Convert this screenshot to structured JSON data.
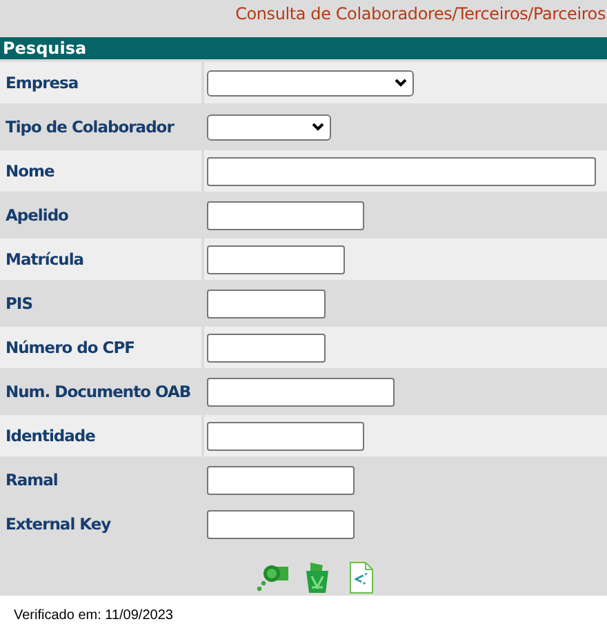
{
  "page_title": "Consulta de Colaboradores/Terceiros/Parceiros",
  "section": {
    "title": "Pesquisa"
  },
  "fields": [
    {
      "label": "Empresa",
      "kind": "select"
    },
    {
      "label": "Tipo de Colaborador",
      "kind": "select"
    },
    {
      "label": "Nome",
      "kind": "text"
    },
    {
      "label": "Apelido",
      "kind": "text"
    },
    {
      "label": "Matrícula",
      "kind": "text"
    },
    {
      "label": "PIS",
      "kind": "text"
    },
    {
      "label": "Número do CPF",
      "kind": "text"
    },
    {
      "label": "Num. Documento OAB",
      "kind": "text"
    },
    {
      "label": "Identidade",
      "kind": "text"
    },
    {
      "label": "Ramal",
      "kind": "text"
    },
    {
      "label": "External Key",
      "kind": "text"
    }
  ],
  "actions": [
    {
      "kind": "search"
    },
    {
      "kind": "clear"
    },
    {
      "kind": "export"
    }
  ],
  "footer": "Verificado em: 11/09/2023"
}
